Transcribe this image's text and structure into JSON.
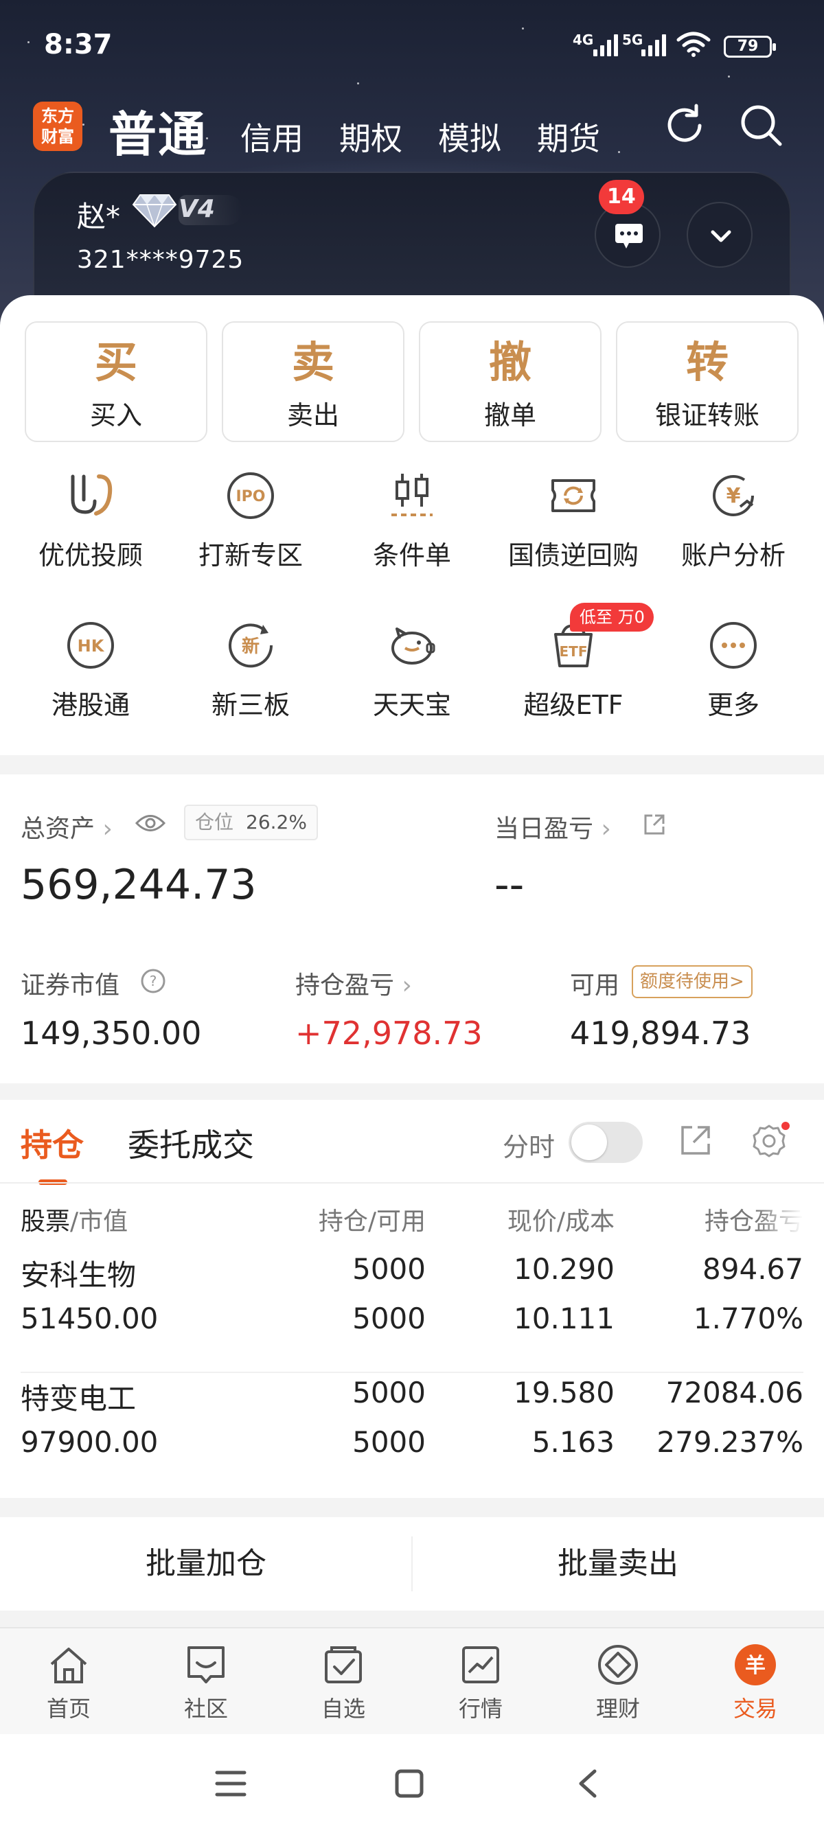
{
  "status_bar": {
    "time": "8:37",
    "sig1": "4G",
    "sig2": "5G",
    "battery": "79"
  },
  "header": {
    "logo_line1": "东方",
    "logo_line2": "财富",
    "tabs": [
      "普通",
      "信用",
      "期权",
      "模拟",
      "期货"
    ],
    "refresh_icon": "refresh-icon",
    "search_icon": "search-icon"
  },
  "account": {
    "name": "赵*",
    "level": "V4",
    "number": "321****9725",
    "message_count": "14"
  },
  "actions": [
    {
      "glyph": "买",
      "label": "买入"
    },
    {
      "glyph": "卖",
      "label": "卖出"
    },
    {
      "glyph": "撤",
      "label": "撤单"
    },
    {
      "glyph": "转",
      "label": "银证转账"
    }
  ],
  "features_row1": [
    {
      "label": "优优投顾",
      "icon": "uu-icon"
    },
    {
      "label": "打新专区",
      "icon": "ipo-icon",
      "icon_text": "IPO"
    },
    {
      "label": "条件单",
      "icon": "candle-icon"
    },
    {
      "label": "国债逆回购",
      "icon": "repo-icon"
    },
    {
      "label": "账户分析",
      "icon": "yen-chart-icon",
      "icon_text": "¥"
    }
  ],
  "features_row2": [
    {
      "label": "港股通",
      "icon": "hk-icon",
      "icon_text": "HK"
    },
    {
      "label": "新三板",
      "icon": "new-board-icon",
      "icon_text": "新"
    },
    {
      "label": "天天宝",
      "icon": "piggy-icon"
    },
    {
      "label": "超级ETF",
      "icon": "etf-icon",
      "icon_text": "ETF"
    },
    {
      "label": "更多",
      "icon": "more-icon"
    }
  ],
  "etf_promo": "低至 万0",
  "assets": {
    "total_label": "总资产",
    "position_label": "仓位",
    "position_value": "26.2%",
    "total_value": "569,244.73",
    "daily_pl_label": "当日盈亏",
    "daily_pl_value": "--",
    "market_value_label": "证券市值",
    "market_value": "149,350.00",
    "holding_pl_label": "持仓盈亏",
    "holding_pl": "+72,978.73",
    "available_label": "可用",
    "quota_badge": "额度待使用>",
    "available_value": "419,894.73"
  },
  "holdings": {
    "tabs": [
      "持仓",
      "委托成交"
    ],
    "time_share_label": "分时",
    "headers": {
      "stock": "股票",
      "stock_sub": "/市值",
      "qty": "持仓/可用",
      "price": "现价/成本",
      "pl": "持仓盈亏"
    },
    "rows": [
      {
        "name": "安科生物",
        "market_value": "51450.00",
        "hold": "5000",
        "avail": "5000",
        "price": "10.290",
        "cost": "10.111",
        "pl": "894.67",
        "pl_pct": "1.770%"
      },
      {
        "name": "特变电工",
        "market_value": "97900.00",
        "hold": "5000",
        "avail": "5000",
        "price": "19.580",
        "cost": "5.163",
        "pl": "72084.06",
        "pl_pct": "279.237%"
      }
    ]
  },
  "batch": {
    "add": "批量加仓",
    "sell": "批量卖出"
  },
  "tabbar": [
    {
      "label": "首页",
      "icon": "home-icon"
    },
    {
      "label": "社区",
      "icon": "community-icon"
    },
    {
      "label": "自选",
      "icon": "watchlist-icon"
    },
    {
      "label": "行情",
      "icon": "market-icon"
    },
    {
      "label": "理财",
      "icon": "wealth-icon"
    },
    {
      "label": "交易",
      "icon": "trade-icon",
      "icon_text": "羊"
    }
  ],
  "colors": {
    "accent": "#ea5b1f",
    "gold": "#c98e4f",
    "red": "#e03232"
  }
}
